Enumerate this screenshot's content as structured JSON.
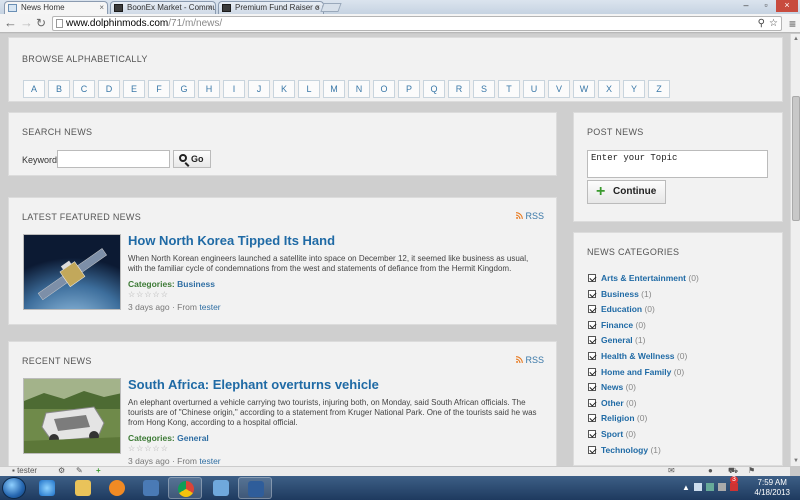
{
  "browser": {
    "tabs": [
      {
        "label": "News Home",
        "active": true
      },
      {
        "label": "BoonEx Market - Commu...",
        "active": false
      },
      {
        "label": "Premium Fund Raiser o m...",
        "active": false
      }
    ],
    "url_domain": "www.dolphinmods.com",
    "url_path": "/71/m/news/",
    "zoom_icon": "magnifier-icon",
    "bookmark_icon": "star-icon",
    "menu_icon": "wrench-menu-icon"
  },
  "browse": {
    "title": "BROWSE ALPHABETICALLY",
    "letters": [
      "A",
      "B",
      "C",
      "D",
      "E",
      "F",
      "G",
      "H",
      "I",
      "J",
      "K",
      "L",
      "M",
      "N",
      "O",
      "P",
      "Q",
      "R",
      "S",
      "T",
      "U",
      "V",
      "W",
      "X",
      "Y",
      "Z"
    ]
  },
  "search": {
    "title": "SEARCH NEWS",
    "keyword_label": "Keyword",
    "keyword_value": "",
    "go_label": "Go"
  },
  "post": {
    "title": "POST NEWS",
    "topic_placeholder": "Enter your Topic",
    "continue_label": "Continue"
  },
  "featured": {
    "title": "LATEST FEATURED NEWS",
    "rss_label": "RSS",
    "item": {
      "headline": "How North Korea Tipped Its Hand",
      "snippet": "When North Korean engineers launched a satellite into space on December 12, it seemed like business as usual, with the familiar cycle of condemnations from the west and statements of defiance from the Hermit Kingdom.",
      "categories_label": "Categories:",
      "category": "Business",
      "stars": "☆☆☆☆☆",
      "age": "3 days ago",
      "from_label": "From",
      "author": "tester"
    }
  },
  "recent": {
    "title": "RECENT NEWS",
    "rss_label": "RSS",
    "item": {
      "headline": "South Africa: Elephant overturns vehicle",
      "snippet": "An elephant overturned a vehicle carrying two tourists, injuring both, on Monday, said South African officials. The tourists are of \"Chinese origin,\" according to a statement from Kruger National Park. One of the tourists said he was from Hong Kong, according to a hospital official.",
      "categories_label": "Categories:",
      "category": "General",
      "stars": "☆☆☆☆☆",
      "age": "3 days ago",
      "from_label": "From",
      "author": "tester"
    }
  },
  "categories": {
    "title": "NEWS CATEGORIES",
    "items": [
      {
        "name": "Arts & Entertainment",
        "count": "(0)"
      },
      {
        "name": "Business",
        "count": "(1)"
      },
      {
        "name": "Education",
        "count": "(0)"
      },
      {
        "name": "Finance",
        "count": "(0)"
      },
      {
        "name": "General",
        "count": "(1)"
      },
      {
        "name": "Health & Wellness",
        "count": "(0)"
      },
      {
        "name": "Home and Family",
        "count": "(0)"
      },
      {
        "name": "News",
        "count": "(0)"
      },
      {
        "name": "Other",
        "count": "(0)"
      },
      {
        "name": "Religion",
        "count": "(0)"
      },
      {
        "name": "Sport",
        "count": "(0)"
      },
      {
        "name": "Technology",
        "count": "(1)"
      }
    ]
  },
  "sitebar": {
    "left_label": "tester"
  },
  "taskbar": {
    "time": "7:59 AM",
    "date": "4/18/2013",
    "notification_count": "3"
  },
  "colors": {
    "link": "#1f6aa5",
    "category_label": "#3c7a35",
    "panel_bg": "#f2f2f2",
    "page_bg": "#cfcfcf"
  }
}
